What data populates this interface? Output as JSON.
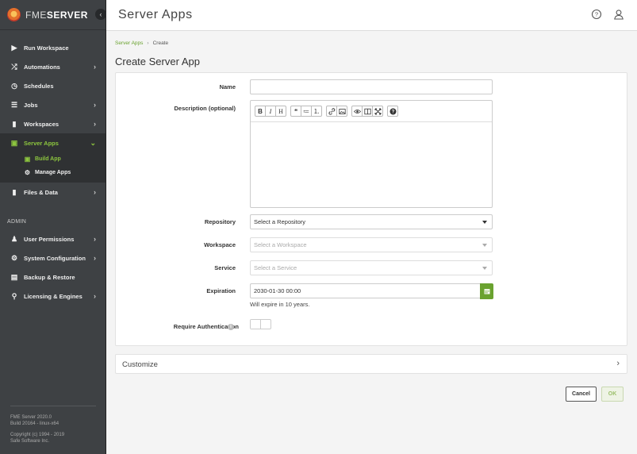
{
  "app": {
    "logo_text_light": "FME",
    "logo_text_bold": "SERVER"
  },
  "header": {
    "title": "Server Apps",
    "help_icon": "question-circle-icon",
    "user_icon": "user-icon"
  },
  "sidebar": {
    "items": [
      {
        "label": "Run Workspace",
        "icon": "play-icon"
      },
      {
        "label": "Automations",
        "icon": "shuffle-icon"
      },
      {
        "label": "Schedules",
        "icon": "clock-icon"
      },
      {
        "label": "Jobs",
        "icon": "list-icon"
      },
      {
        "label": "Workspaces",
        "icon": "file-icon"
      },
      {
        "label": "Server Apps",
        "icon": "app-icon"
      },
      {
        "label": "Files & Data",
        "icon": "folder-icon"
      }
    ],
    "sub_items": [
      {
        "label": "Build App",
        "icon": "build-icon"
      },
      {
        "label": "Manage Apps",
        "icon": "gear-icon"
      }
    ],
    "admin_label": "ADMIN",
    "admin_items": [
      {
        "label": "User Permissions",
        "icon": "users-icon"
      },
      {
        "label": "System Configuration",
        "icon": "gear-icon"
      },
      {
        "label": "Backup & Restore",
        "icon": "save-icon"
      },
      {
        "label": "Licensing & Engines",
        "icon": "key-icon"
      }
    ],
    "footer": {
      "version": "FME Server 2020.0",
      "build": "Build 20164 - linux-x64",
      "copyright": "Copyright (c) 1994 - 2019",
      "company": "Safe Software Inc."
    }
  },
  "breadcrumb": {
    "parent": "Server Apps",
    "current": "Create"
  },
  "page_title": "Create Server App",
  "form": {
    "name_label": "Name",
    "name_value": "",
    "description_label": "Description (optional)",
    "toolbar": [
      [
        "B",
        "I",
        "H"
      ],
      [
        "❝",
        "≔",
        "⒈"
      ],
      [
        "🔗",
        "🖼"
      ],
      [
        "👁",
        "◫",
        "⤢"
      ],
      [
        "?"
      ]
    ],
    "repository_label": "Repository",
    "repository_value": "Select a Repository",
    "workspace_label": "Workspace",
    "workspace_value": "Select a Workspace",
    "service_label": "Service",
    "service_value": "Select a Service",
    "expiration_label": "Expiration",
    "expiration_value": "2030-01-30 00:00",
    "expiration_note": "Will expire in 10 years.",
    "require_auth_label": "Require Authentication",
    "require_auth_value": false
  },
  "customize": {
    "label": "Customize"
  },
  "buttons": {
    "cancel": "Cancel",
    "ok": "OK"
  },
  "colors": {
    "sidebar_bg": "#3e4144",
    "accent_green": "#8dc63f",
    "button_green": "#6aa22f"
  }
}
